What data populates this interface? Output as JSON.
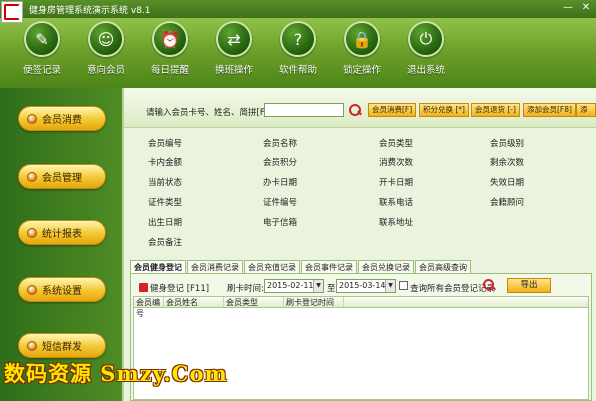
{
  "window": {
    "title": "健身房管理系统演示系统  v8.1",
    "minimize": "—",
    "close": "✕"
  },
  "toolbar": [
    {
      "label": "便签记录",
      "icon": "note-icon",
      "glyph": "✎"
    },
    {
      "label": "意向会员",
      "icon": "person-icon",
      "glyph": "☺"
    },
    {
      "label": "每日提醒",
      "icon": "alarm-clock-icon",
      "glyph": "⏰"
    },
    {
      "label": "换班操作",
      "icon": "shift-swap-icon",
      "glyph": "⇄"
    },
    {
      "label": "软件帮助",
      "icon": "help-icon",
      "glyph": "?"
    },
    {
      "label": "锁定操作",
      "icon": "lock-icon",
      "glyph": "🔒"
    },
    {
      "label": "退出系统",
      "icon": "power-icon",
      "glyph": "⏻"
    }
  ],
  "nav": [
    "会员消费",
    "会员管理",
    "统计报表",
    "系统设置",
    "短信群发"
  ],
  "search": {
    "label": "请输入会员卡号、姓名、简拼[F3]",
    "value": "",
    "buttons": [
      "会员消费[F]",
      "积分兑换 [*]",
      "会员退货 [-]",
      "添加会员[F8]",
      "添"
    ]
  },
  "fields": [
    [
      "会员编号",
      "会员名称",
      "会员类型",
      "会员级别"
    ],
    [
      "卡内金额",
      "会员积分",
      "消费次数",
      "剩余次数"
    ],
    [
      "当前状态",
      "办卡日期",
      "开卡日期",
      "失效日期"
    ],
    [
      "证件类型",
      "证件编号",
      "联系电话",
      "会籍顾问"
    ],
    [
      "出生日期",
      "电子信箱",
      "联系地址",
      ""
    ],
    [
      "会员备注",
      "",
      "",
      ""
    ]
  ],
  "tabs": [
    "会员健身登记",
    "会员消费记录",
    "会员充值记录",
    "会员事件记录",
    "会员兑换记录",
    "会员高级查询"
  ],
  "checkin": {
    "label": "健身登记 [F11]",
    "time_label": "刷卡时间:",
    "date_from": "2015-02-11",
    "to_label": "至",
    "date_to": "2015-03-14",
    "all_members_label": "查询所有会员登记记录",
    "export_label": "导出"
  },
  "grid": {
    "columns": [
      "会员编号",
      "会员姓名",
      "会员类型",
      "刷卡登记时间"
    ]
  },
  "watermark": "数码资源 Smzy.Com"
}
